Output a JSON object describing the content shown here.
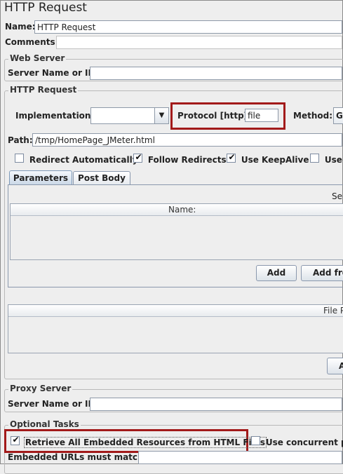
{
  "title": "HTTP Request",
  "name": {
    "label": "Name:",
    "value": "HTTP Request"
  },
  "comments": {
    "label": "Comments:",
    "value": ""
  },
  "web_server": {
    "title": "Web Server",
    "server_label": "Server Name or IP:",
    "server_value": ""
  },
  "http_request": {
    "title": "HTTP Request",
    "implementation_label": "Implementation:",
    "implementation_value": "",
    "protocol_label": "Protocol [http]:",
    "protocol_value": "file",
    "method_label": "Method:",
    "method_value": "G",
    "path_label": "Path:",
    "path_value": "/tmp/HomePage_JMeter.html",
    "checkboxes": [
      {
        "label": "Redirect Automatically",
        "checked": false
      },
      {
        "label": "Follow Redirects",
        "checked": true
      },
      {
        "label": "Use KeepAlive",
        "checked": true
      },
      {
        "label": "Use m",
        "checked": false
      }
    ],
    "tabs": [
      "Parameters",
      "Post Body"
    ],
    "params_header_right": "Se",
    "params_col_name": "Name:",
    "add_button": "Add",
    "add_from_button": "Add fro",
    "files_header": "File P",
    "files_button": "A"
  },
  "proxy": {
    "title": "Proxy Server",
    "server_label": "Server Name or IP:",
    "server_value": ""
  },
  "optional": {
    "title": "Optional Tasks",
    "retrieve_label": "Retrieve All Embedded Resources from HTML Files",
    "retrieve_checked": true,
    "concurrent_label": "Use concurrent po",
    "concurrent_checked": false,
    "embedded_label": "Embedded URLs must match:"
  },
  "check_mark": "✔",
  "colors": {
    "highlight": "#a21a1a",
    "background": "#eeeeee"
  }
}
